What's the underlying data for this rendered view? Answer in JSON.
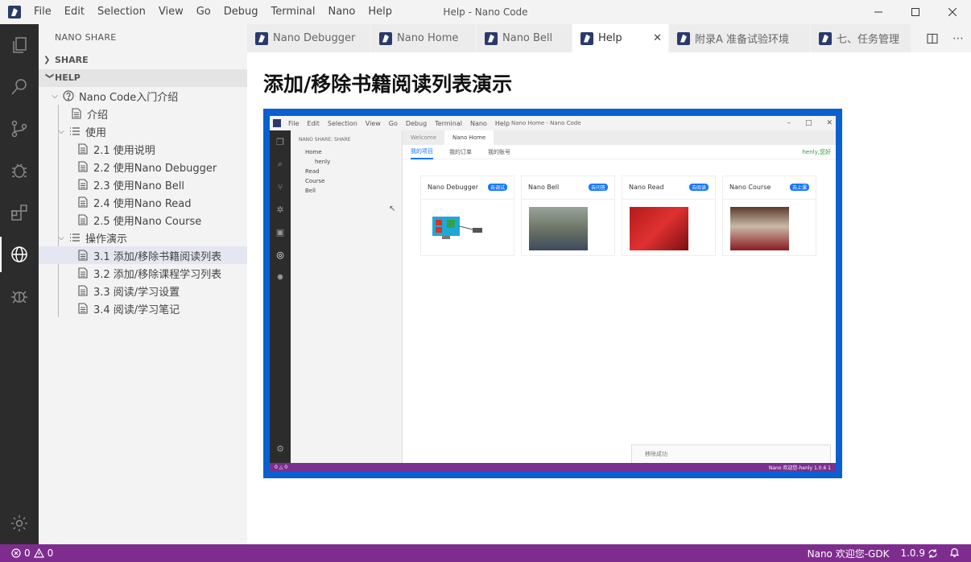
{
  "titlebar": {
    "menus": [
      "File",
      "Edit",
      "Selection",
      "View",
      "Go",
      "Debug",
      "Terminal",
      "Nano",
      "Help"
    ],
    "title": "Help - Nano Code"
  },
  "sidebar": {
    "title": "NANO SHARE",
    "sections": [
      {
        "label": "SHARE"
      },
      {
        "label": "HELP"
      }
    ],
    "tree": [
      {
        "label": "Nano Code入门介绍",
        "icon": "help-circle-icon"
      },
      {
        "label": "介绍",
        "icon": "document-icon"
      },
      {
        "label": "使用",
        "icon": "list-icon"
      },
      {
        "label": "2.1 使用说明",
        "icon": "document-icon"
      },
      {
        "label": "2.2 使用Nano Debugger",
        "icon": "document-icon"
      },
      {
        "label": "2.3 使用Nano Bell",
        "icon": "document-icon"
      },
      {
        "label": "2.4 使用Nano Read",
        "icon": "document-icon"
      },
      {
        "label": "2.5 使用Nano Course",
        "icon": "document-icon"
      },
      {
        "label": "操作演示",
        "icon": "list-icon"
      },
      {
        "label": "3.1 添加/移除书籍阅读列表",
        "icon": "document-icon"
      },
      {
        "label": "3.2 添加/移除课程学习列表",
        "icon": "document-icon"
      },
      {
        "label": "3.3 阅读/学习设置",
        "icon": "document-icon"
      },
      {
        "label": "3.4 阅读/学习笔记",
        "icon": "document-icon"
      }
    ]
  },
  "tabs": [
    {
      "label": "Nano Debugger"
    },
    {
      "label": "Nano Home"
    },
    {
      "label": "Nano Bell"
    },
    {
      "label": "Help"
    },
    {
      "label": "附录A 准备试验环境"
    },
    {
      "label": "七、任务管理"
    }
  ],
  "content": {
    "title": "添加/移除书籍阅读列表演示"
  },
  "embedded": {
    "menus": [
      "File",
      "Edit",
      "Selection",
      "View",
      "Go",
      "Debug",
      "Terminal",
      "Nano",
      "Help"
    ],
    "title": "Nano Home - Nano Code",
    "side_title": "NANO SHARE: SHARE",
    "side_items": [
      "Home",
      "henly",
      "Read",
      "Course",
      "Bell"
    ],
    "tabs": [
      "Welcome",
      "Nano Home"
    ],
    "nav": [
      "我的项目",
      "我的订单",
      "我的账号"
    ],
    "user": "henly,您好",
    "cards": [
      {
        "name": "Nano Debugger",
        "badge": "去调试"
      },
      {
        "name": "Nano Bell",
        "badge": "去问答"
      },
      {
        "name": "Nano Read",
        "badge": "去阅读"
      },
      {
        "name": "Nano Course",
        "badge": "去上课"
      }
    ],
    "toast": "移除成功",
    "status_left": "0 △ 0",
    "status_right": "Nano 欢迎您-henly   1.0.6   1"
  },
  "statusbar": {
    "errors": "0",
    "warnings": "0",
    "welcome": "Nano 欢迎您-GDK",
    "version": "1.0.9"
  },
  "colors": {
    "activity_bg": "#2c2c2c",
    "status_bg": "#7e2d8f",
    "selected_row": "#e4e6f1"
  }
}
